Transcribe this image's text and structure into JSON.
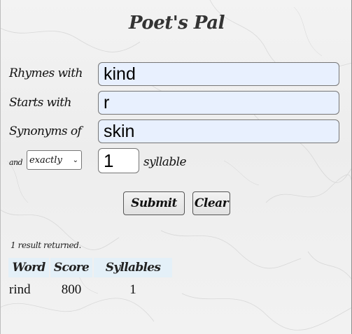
{
  "app": {
    "title": "Poet's Pal"
  },
  "form": {
    "rhymes_label": "Rhymes with",
    "rhymes_value": "kind",
    "starts_label": "Starts with",
    "starts_value": "r",
    "synonyms_label": "Synonyms of",
    "synonyms_value": "skin",
    "and_label": "and",
    "count_mode_selected": "exactly",
    "syllable_count": "1",
    "syllable_label": "syllable",
    "submit_label": "Submit",
    "clear_label": "Clear"
  },
  "results": {
    "summary": "1 result returned.",
    "columns": [
      "Word",
      "Score",
      "Syllables"
    ],
    "rows": [
      {
        "word": "rind",
        "score": "800",
        "syllables": "1"
      }
    ]
  },
  "colors": {
    "input_autofill_bg": "#e8f0fe",
    "header_bg": "#e4f0f8"
  }
}
